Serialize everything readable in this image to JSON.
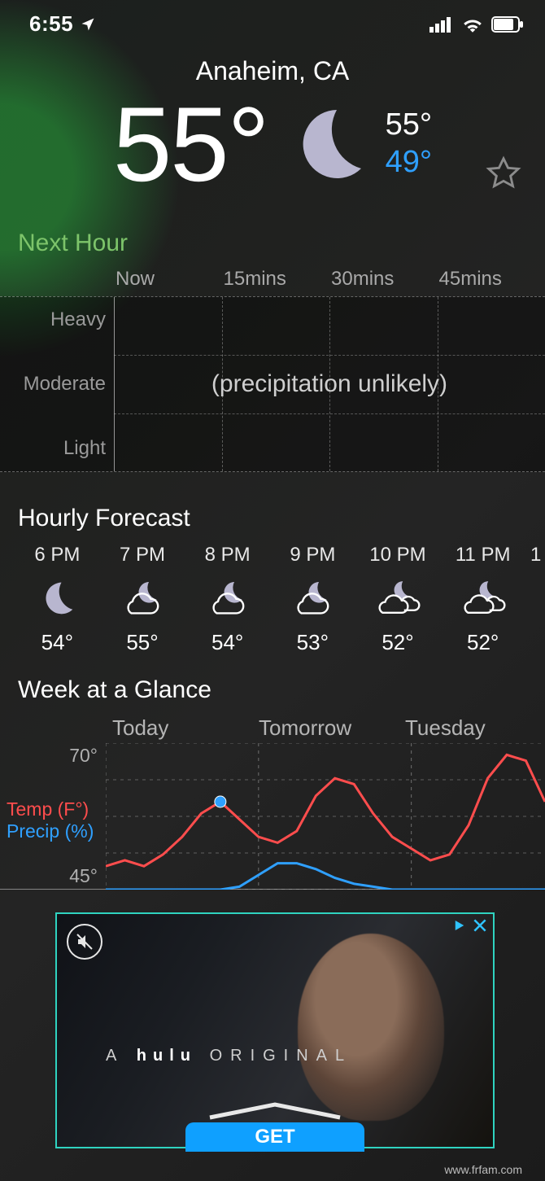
{
  "status": {
    "time": "6:55"
  },
  "header": {
    "location": "Anaheim, CA",
    "big_temp": "55°",
    "high": "55°",
    "low": "49°"
  },
  "next_hour": {
    "title": "Next Hour",
    "time_labels": [
      "Now",
      "15mins",
      "30mins",
      "45mins"
    ],
    "intensity_labels": [
      "Heavy",
      "Moderate",
      "Light"
    ],
    "message": "(precipitation unlikely)"
  },
  "hourly": {
    "title": "Hourly Forecast",
    "items": [
      {
        "time": "6 PM",
        "icon": "moon",
        "temp": "54°"
      },
      {
        "time": "7 PM",
        "icon": "moon-cloud",
        "temp": "55°"
      },
      {
        "time": "8 PM",
        "icon": "moon-cloud",
        "temp": "54°"
      },
      {
        "time": "9 PM",
        "icon": "moon-cloud",
        "temp": "53°"
      },
      {
        "time": "10 PM",
        "icon": "moon-clouds",
        "temp": "52°"
      },
      {
        "time": "11 PM",
        "icon": "moon-clouds",
        "temp": "52°"
      }
    ]
  },
  "week": {
    "title": "Week at a Glance",
    "y_max_label": "70°",
    "y_min_label": "45°",
    "legend_temp": "Temp (F°)",
    "legend_precip": "Precip (%)",
    "day_labels": [
      "Today",
      "Tomorrow",
      "Tuesday"
    ]
  },
  "chart_data": {
    "type": "line",
    "title": "Week at a Glance",
    "xlabel": "",
    "ylabel": "",
    "ylim": [
      45,
      70
    ],
    "x": [
      0,
      1,
      2,
      3,
      4,
      5,
      6,
      7,
      8,
      9,
      10,
      11,
      12,
      13,
      14,
      15,
      16,
      17,
      18,
      19,
      20,
      21,
      22,
      23
    ],
    "series": [
      {
        "name": "Temp (F°)",
        "color": "#ff4d4d",
        "values": [
          49,
          50,
          49,
          51,
          54,
          58,
          60,
          57,
          54,
          53,
          55,
          61,
          64,
          63,
          58,
          54,
          52,
          50,
          51,
          56,
          64,
          68,
          67,
          60
        ]
      },
      {
        "name": "Precip (%)",
        "color": "#2fa0ff",
        "values": [
          0,
          0,
          0,
          0,
          0,
          0,
          0,
          2,
          10,
          18,
          18,
          14,
          8,
          4,
          2,
          0,
          0,
          0,
          0,
          0,
          0,
          0,
          0,
          0
        ]
      }
    ],
    "marker": {
      "x": 6,
      "series": "Temp (F°)"
    },
    "day_dividers_at_x": [
      0,
      8,
      16
    ]
  },
  "ad": {
    "tag_pre": "A ",
    "tag_brand": "hulu",
    "tag_post": " ORIGINAL",
    "cta": "GET"
  },
  "watermark": "www.frfam.com"
}
